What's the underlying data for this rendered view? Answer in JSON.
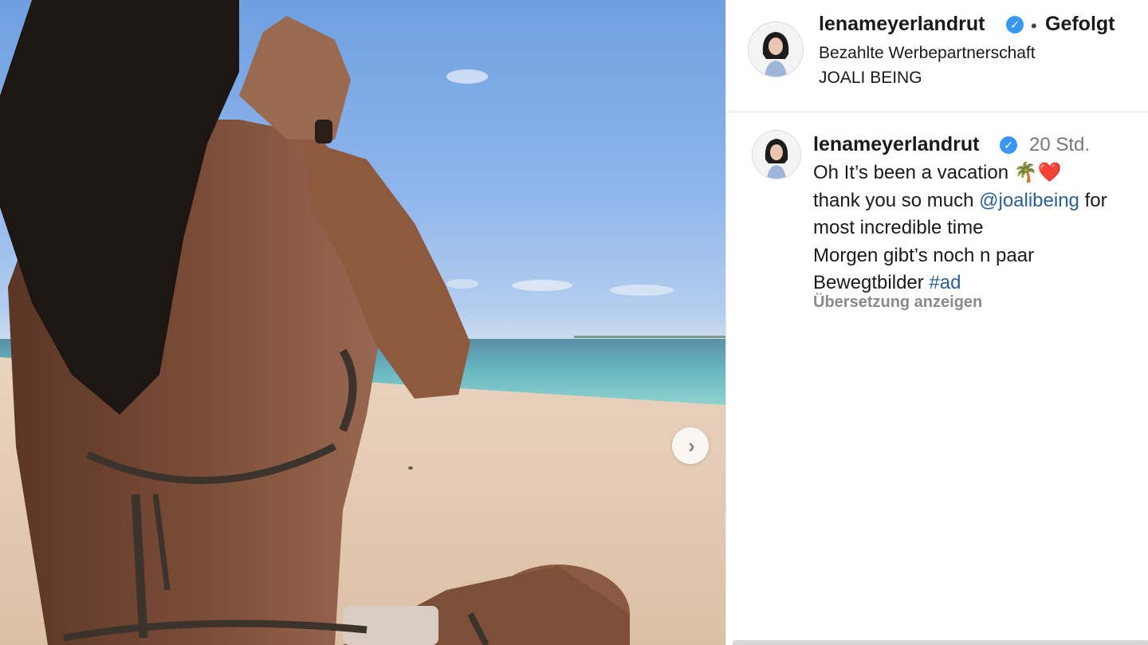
{
  "post": {
    "username": "lenameyerlandrut",
    "verified_icon": "verified-badge-icon",
    "separator": "•",
    "follow_status": "Gefolgt",
    "paid_partnership": "Bezahlte Werbepartnerschaft",
    "partner": "JOALI BEING"
  },
  "comment": {
    "username": "lenameyerlandrut",
    "time": "20 Std.",
    "caption_line1_text": "Oh It’s been a vacation ",
    "caption_line1_emoji": "🌴❤️",
    "caption_line2_text": "thank you so much ",
    "caption_line2_mention": "@joalibeing",
    "caption_line2_after": " for",
    "caption_line3": "most incredible time",
    "caption_line4": "Morgen gibt’s noch n paar",
    "caption_line5_text": "Bewegtbilder ",
    "caption_line5_hashtag": "#ad",
    "translate_label": "Übersetzung anzeigen"
  },
  "media": {
    "next_icon": "chevron-right-icon",
    "next_glyph": "›"
  },
  "colors": {
    "accent_link": "#2a5f98",
    "verified": "#3897f0",
    "muted": "#8a8a8a"
  }
}
